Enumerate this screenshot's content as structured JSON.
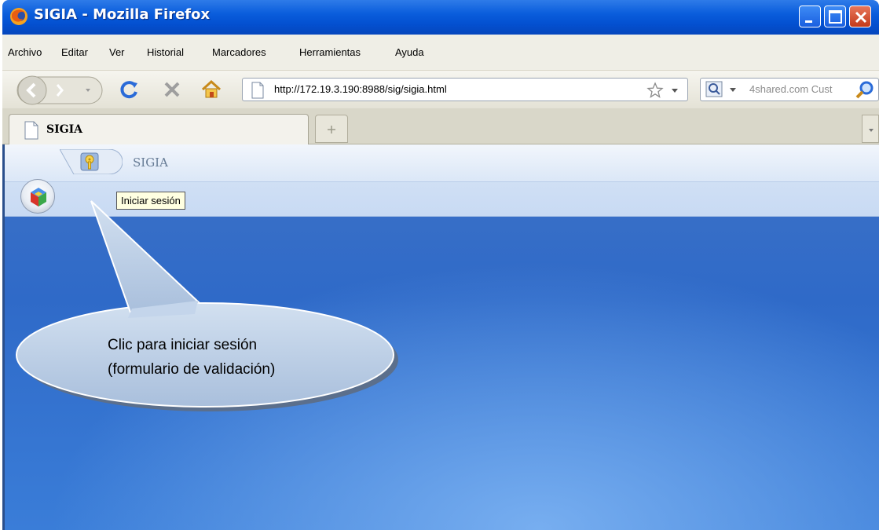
{
  "window": {
    "title": "SIGIA - Mozilla Firefox"
  },
  "menu": {
    "items": [
      "Archivo",
      "Editar",
      "Ver",
      "Historial",
      "Marcadores",
      "Herramientas",
      "Ayuda"
    ]
  },
  "navbar": {
    "url": "http://172.19.3.190:8988/sig/sigia.html",
    "search_placeholder": "4shared.com Cust"
  },
  "tabs": [
    {
      "label": "SIGIA"
    }
  ],
  "app": {
    "title": "SIGIA",
    "tooltip": "Iniciar sesión"
  },
  "callout": {
    "line1": "Clic para iniciar sesión",
    "line2": "(formulario de validación)"
  },
  "colors": {
    "titlebar": "#0a5ddc",
    "desktop_blue": "#3a7dd8",
    "callout_fill": "#b9cde6"
  }
}
